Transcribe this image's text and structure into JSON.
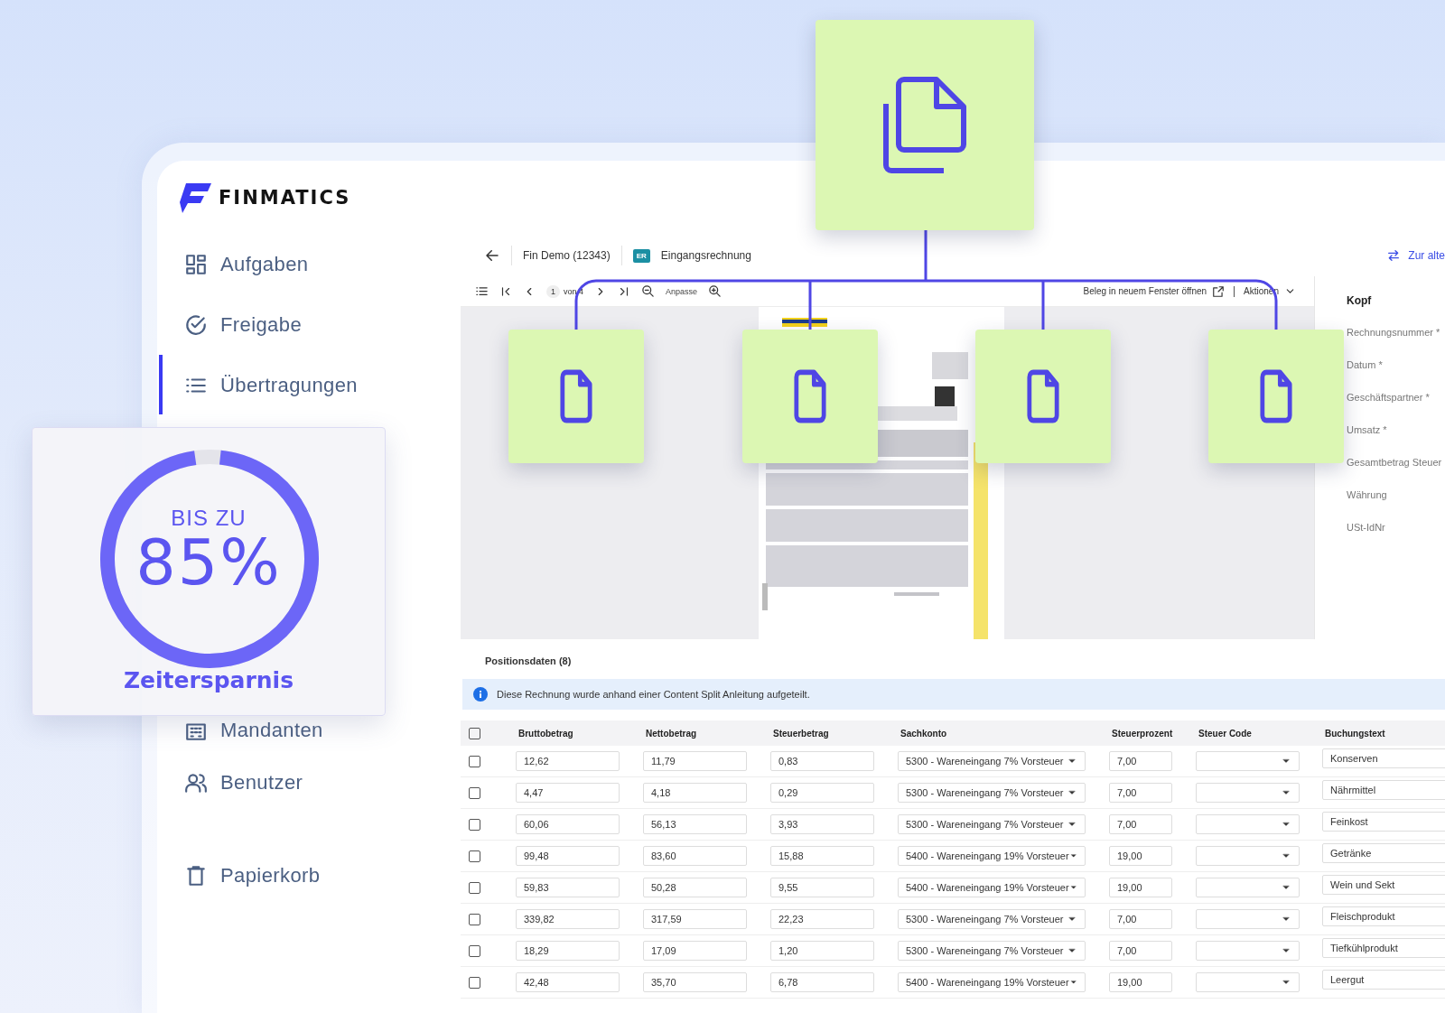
{
  "brand": {
    "name": "FINMATICS"
  },
  "sidebar": {
    "items": [
      {
        "label": "Aufgaben",
        "kind": "tasks",
        "selected": false
      },
      {
        "label": "Freigabe",
        "kind": "approval",
        "selected": false
      },
      {
        "label": "Übertragungen",
        "kind": "transfers",
        "selected": true
      },
      {
        "label": "Mandanten",
        "kind": "clients",
        "selected": false
      },
      {
        "label": "Benutzer",
        "kind": "users",
        "selected": false
      },
      {
        "label": "Papierkorb",
        "kind": "trash",
        "selected": false
      }
    ]
  },
  "document": {
    "client": "Fin Demo (12343)",
    "type_badge": "ER",
    "type": "Eingangsrechnung",
    "switch_link": "Zur alte"
  },
  "viewer_toolbar": {
    "page": "1",
    "page_of": "von 4",
    "zoom_mode": "Anpasse",
    "open_new_window": "Beleg in neuem Fenster öffnen",
    "actions": "Aktionen"
  },
  "header_panel": {
    "title": "Kopf",
    "fields": [
      "Rechnungsnummer *",
      "Datum *",
      "Geschäftspartner *",
      "Umsatz *",
      "Gesamtbetrag Steuer",
      "Währung",
      "USt-IdNr"
    ]
  },
  "positions": {
    "title": "Positionsdaten (8)",
    "info": "Diese Rechnung wurde anhand einer Content Split Anleitung aufgeteilt.",
    "all_checked": false,
    "columns": [
      "Bruttobetrag",
      "Nettobetrag",
      "Steuerbetrag",
      "Sachkonto",
      "Steuerprozent",
      "Steuer Code",
      "Buchungstext"
    ],
    "rows": [
      {
        "checked": false,
        "bruttobetrag": "12,62",
        "nettobetrag": "11,79",
        "steuerbetrag": "0,83",
        "sachkonto": "5300 - Wareneingang 7% Vorsteuer",
        "steuerprozent": "7,00",
        "buchungstext": "Konserven"
      },
      {
        "checked": false,
        "bruttobetrag": "4,47",
        "nettobetrag": "4,18",
        "steuerbetrag": "0,29",
        "sachkonto": "5300 - Wareneingang 7% Vorsteuer",
        "steuerprozent": "7,00",
        "buchungstext": "Nährmittel"
      },
      {
        "checked": false,
        "bruttobetrag": "60,06",
        "nettobetrag": "56,13",
        "steuerbetrag": "3,93",
        "sachkonto": "5300 - Wareneingang 7% Vorsteuer",
        "steuerprozent": "7,00",
        "buchungstext": "Feinkost"
      },
      {
        "checked": false,
        "bruttobetrag": "99,48",
        "nettobetrag": "83,60",
        "steuerbetrag": "15,88",
        "sachkonto": "5400 - Wareneingang 19% Vorsteuer",
        "steuerprozent": "19,00",
        "buchungstext": "Getränke"
      },
      {
        "checked": false,
        "bruttobetrag": "59,83",
        "nettobetrag": "50,28",
        "steuerbetrag": "9,55",
        "sachkonto": "5400 - Wareneingang 19% Vorsteuer",
        "steuerprozent": "19,00",
        "buchungstext": "Wein und Sekt"
      },
      {
        "checked": false,
        "bruttobetrag": "339,82",
        "nettobetrag": "317,59",
        "steuerbetrag": "22,23",
        "sachkonto": "5300 - Wareneingang 7% Vorsteuer",
        "steuerprozent": "7,00",
        "buchungstext": "Fleischprodukt"
      },
      {
        "checked": false,
        "bruttobetrag": "18,29",
        "nettobetrag": "17,09",
        "steuerbetrag": "1,20",
        "sachkonto": "5300 - Wareneingang 7% Vorsteuer",
        "steuerprozent": "7,00",
        "buchungstext": "Tiefkühlprodukt"
      },
      {
        "checked": false,
        "bruttobetrag": "42,48",
        "nettobetrag": "35,70",
        "steuerbetrag": "6,78",
        "sachkonto": "5400 - Wareneingang 19% Vorsteuer",
        "steuerprozent": "19,00",
        "buchungstext": "Leergut"
      }
    ]
  },
  "promo": {
    "label": "BIS ZU",
    "value": "85%",
    "caption": "Zeitersparnis",
    "level": 0.96
  }
}
